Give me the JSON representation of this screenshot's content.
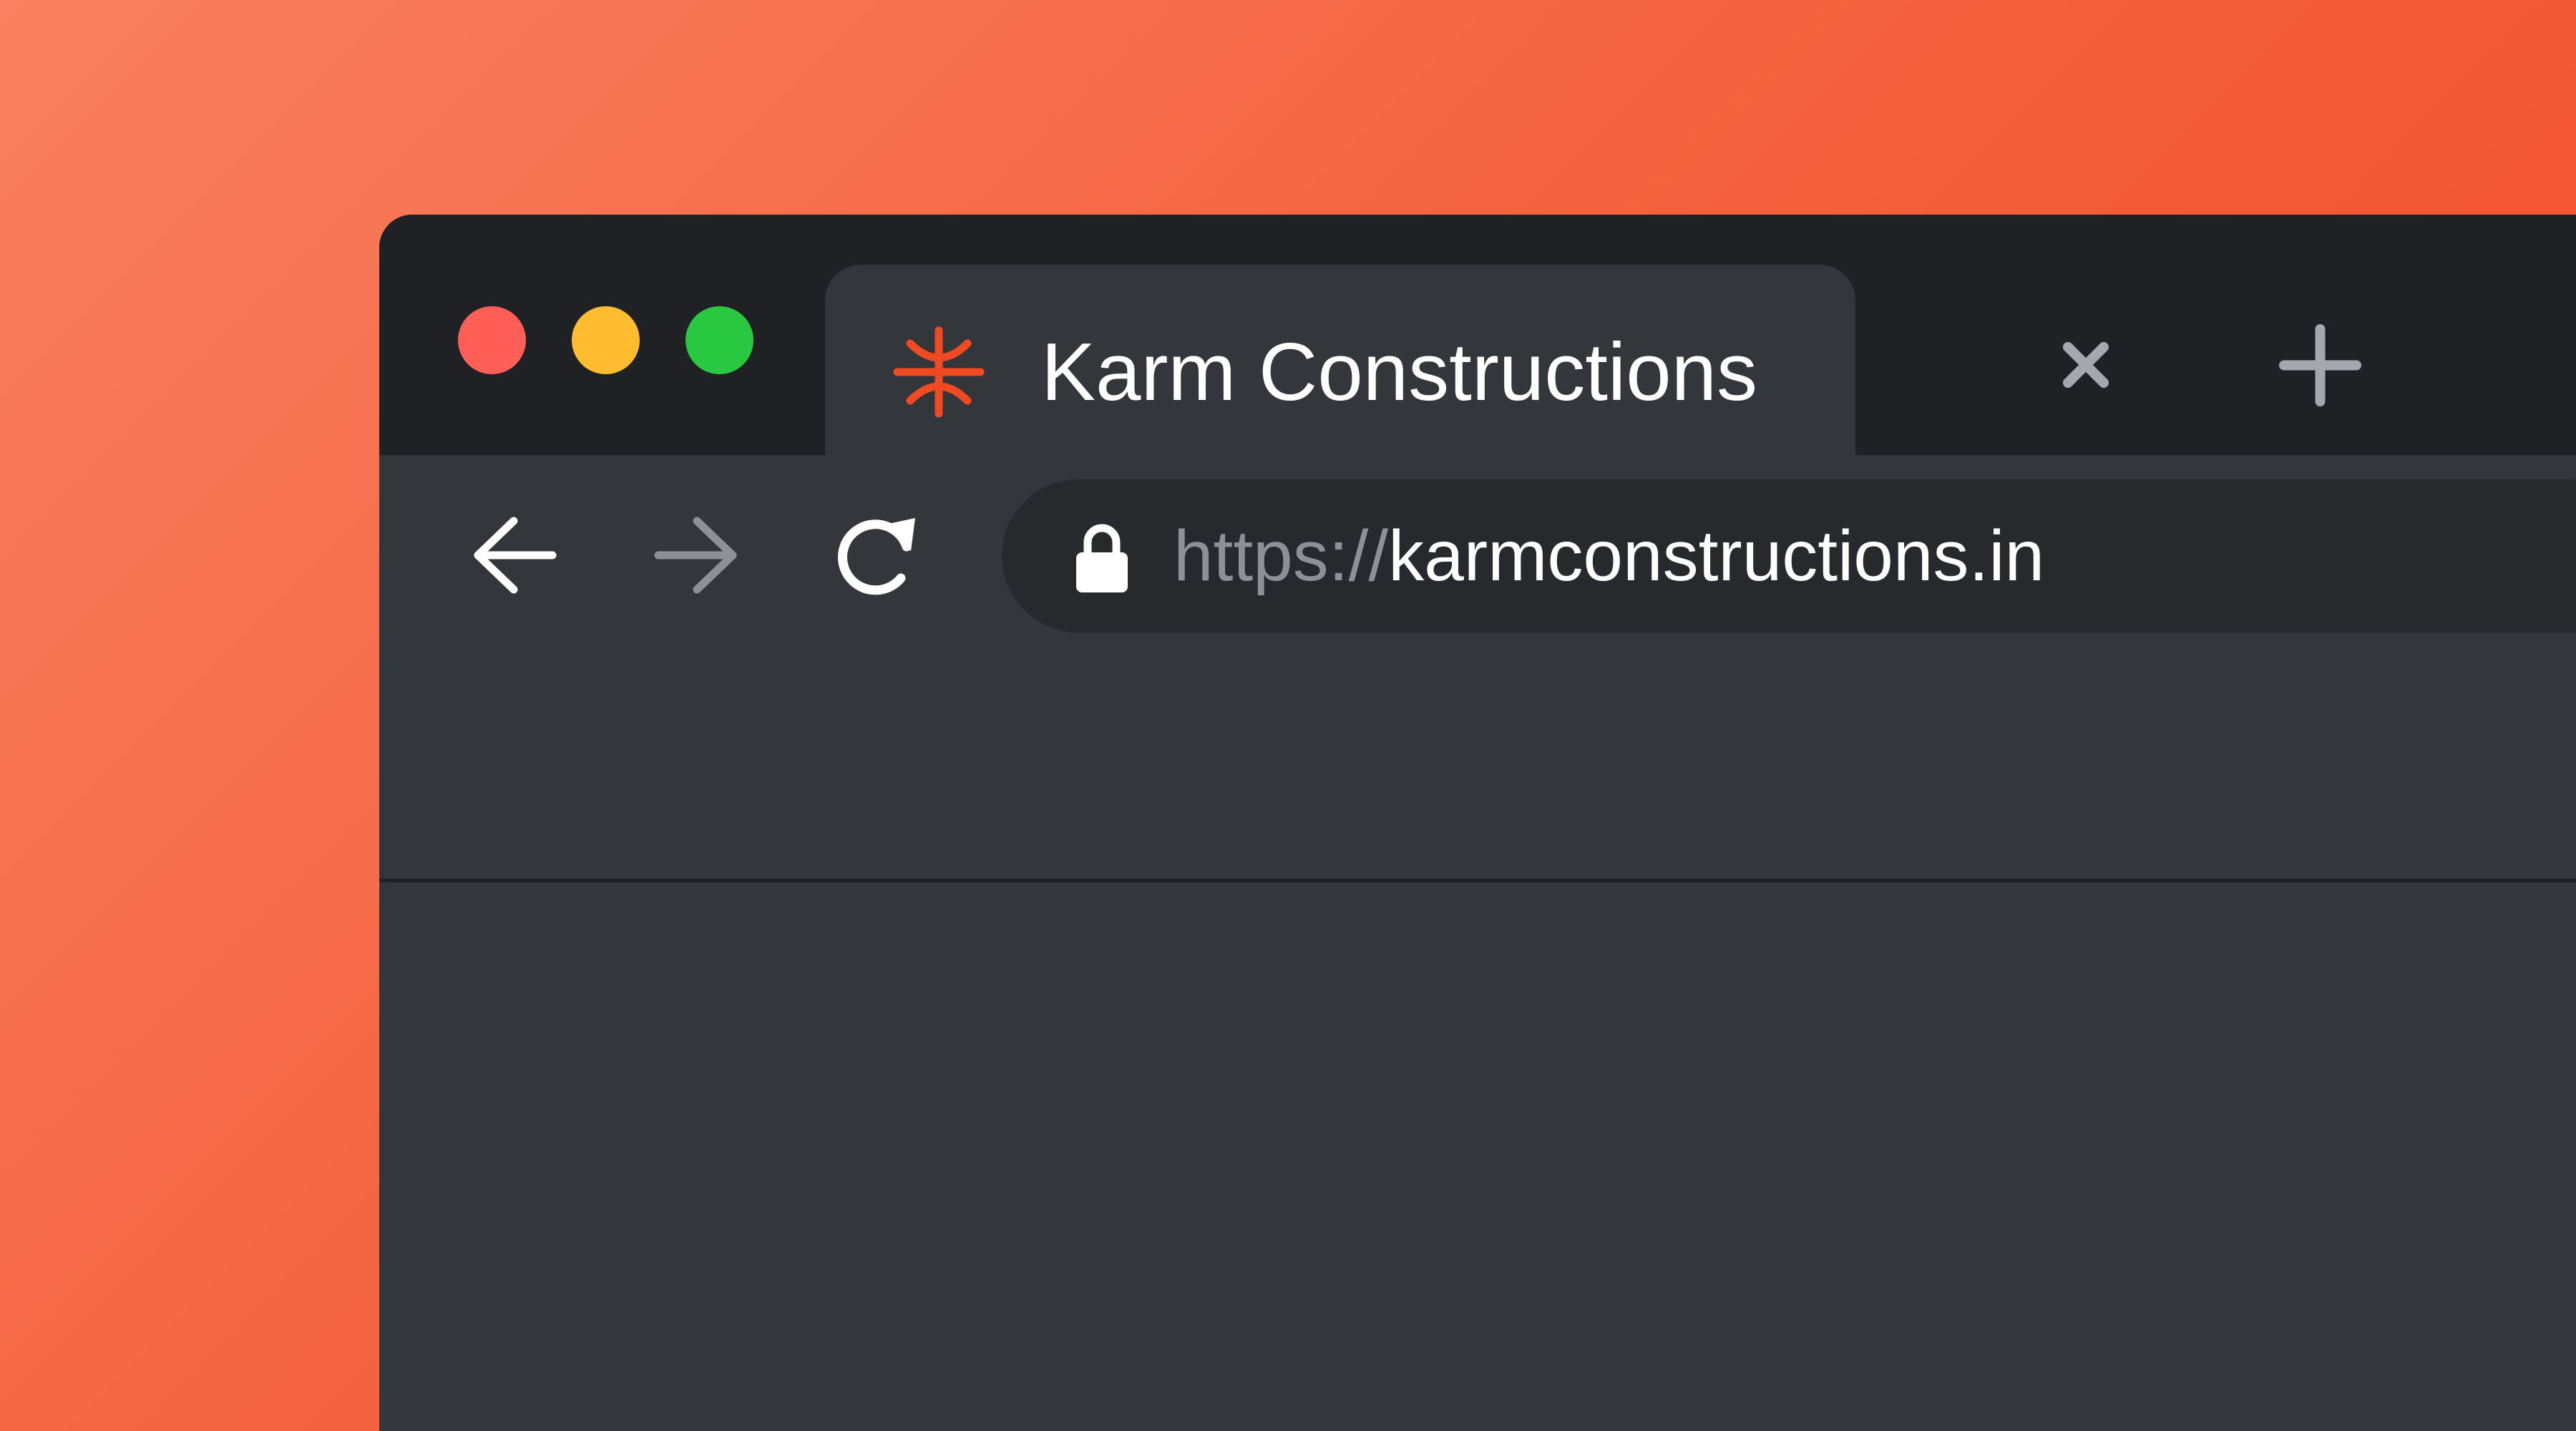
{
  "window": {
    "traffic_lights": [
      {
        "name": "close",
        "color": "#ff5f57"
      },
      {
        "name": "minimize",
        "color": "#febc2e"
      },
      {
        "name": "maximize",
        "color": "#28c840"
      }
    ]
  },
  "tab": {
    "title": "Karm Constructions",
    "favicon": "karm-asterisk-logo",
    "favicon_color": "#f04a23",
    "close_icon": "close-icon"
  },
  "new_tab": {
    "icon": "plus-icon"
  },
  "toolbar": {
    "back_icon": "arrow-left-icon",
    "forward_icon": "arrow-right-icon",
    "reload_icon": "reload-icon",
    "forward_enabled": false
  },
  "address_bar": {
    "lock_icon": "lock-icon",
    "scheme": "https://",
    "host": "karmconstructions.in"
  },
  "colors": {
    "background_gradient_start": "#f98060",
    "background_gradient_end": "#ef4622",
    "tab_strip": "#1f2124",
    "toolbar": "#33363a",
    "omnibox": "#27292c"
  }
}
